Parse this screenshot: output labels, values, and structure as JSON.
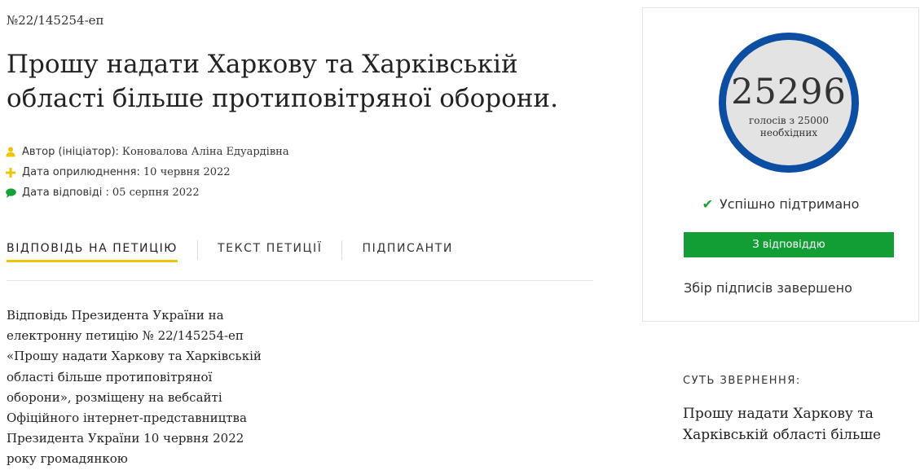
{
  "petition": {
    "number": "№22/145254-еп",
    "title": "Прошу надати Харкову та Харківській області більше протиповітряної оборони."
  },
  "meta": [
    {
      "icon": "user-icon",
      "label": "Автор (ініціатор):",
      "value": "Коновалова Аліна Едуардівна",
      "color": "#f2c300"
    },
    {
      "icon": "plus-icon",
      "label": "Дата оприлюднення:",
      "value": "10 червня 2022",
      "color": "#f2c300"
    },
    {
      "icon": "comment-icon",
      "label": "Дата відповіді :",
      "value": "05 серпня 2022",
      "color": "#16a135"
    }
  ],
  "tabs": [
    {
      "label": "Відповідь на петицію",
      "active": true
    },
    {
      "label": "Текст петиції",
      "active": false
    },
    {
      "label": "Підписанти",
      "active": false
    }
  ],
  "answer_text": "Відповідь Президента України на електронну петицію № 22/145254-еп «Прошу надати Харкову та Харківській області більше протиповітряної оборони», розміщену на вебсайті Офіційного інтернет-представництва Президента України 10 червня 2022 року громадянкою",
  "sidebar": {
    "votes": "25296",
    "votes_caption_line1": "голосів з 25000",
    "votes_caption_line2": "необхідних",
    "status": "Успішно підтримано",
    "answer_button": "З відповіддю",
    "collection_status": "Збір підписів завершено",
    "essence_label": "СУТЬ ЗВЕРНЕННЯ:",
    "essence_text": "Прошу надати Харкову та Харківській області більше"
  },
  "colors": {
    "accent_yellow": "#f2c300",
    "success_green": "#139e35",
    "counter_ring": "#0b4ea2"
  }
}
